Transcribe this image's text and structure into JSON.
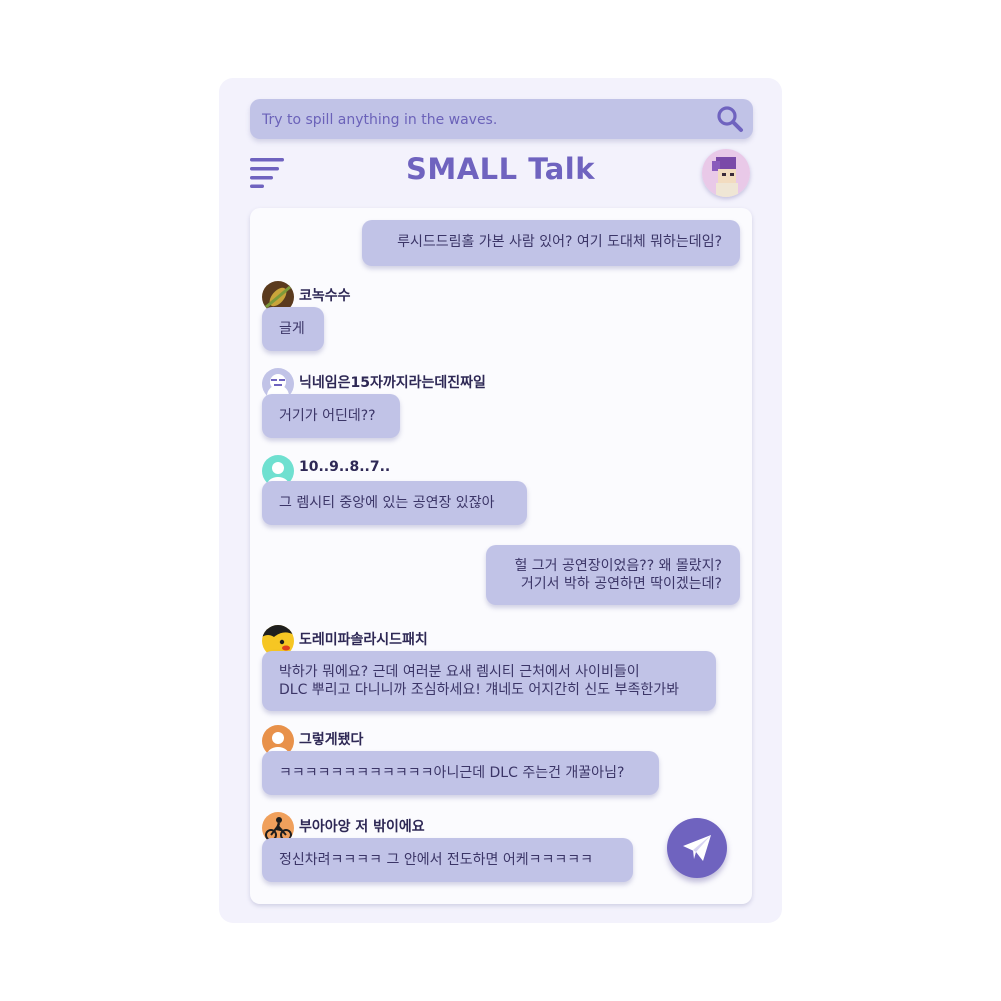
{
  "search": {
    "placeholder": "Try to spill anything in the waves."
  },
  "header": {
    "title": "SMALL Talk"
  },
  "colors": {
    "accent": "#6f63bf",
    "bubble": "#c1c3e7",
    "panel": "#f3f2fc",
    "text": "#3b3567"
  },
  "icons": {
    "search": "search-icon",
    "menu": "menu-icon",
    "send": "paper-plane-icon"
  },
  "messages": [
    {
      "type": "outgoing",
      "lines": [
        "루시드드림홀 가본 사람 있어? 여기 도대체 뭐하는데임?"
      ]
    },
    {
      "type": "incoming",
      "user": "코녹수수",
      "avatar": "corn-avatar",
      "lines": [
        "글게"
      ]
    },
    {
      "type": "incoming",
      "user": "닉네임은15자까지라는데진짜일",
      "avatar": "snowman-avatar",
      "lines": [
        "거기가 어딘데??"
      ]
    },
    {
      "type": "incoming",
      "user": "10..9..8..7..",
      "avatar": "default-teal-avatar",
      "lines": [
        "그 렘시티 중앙에 있는 공연장 있잖아"
      ]
    },
    {
      "type": "outgoing",
      "lines": [
        "헐 그거 공연장이었음?? 왜 몰랐지?",
        "거기서 박하 공연하면 딱이겠는데?"
      ]
    },
    {
      "type": "incoming",
      "user": "도레미파솔라시드패치",
      "avatar": "yellow-bird-avatar",
      "lines": [
        "박하가 뭐에요? 근데 여러분 요새 렘시티 근처에서 사이비들이",
        "DLC 뿌리고 다니니까 조심하세요! 걔네도 어지간히 신도 부족한가봐"
      ]
    },
    {
      "type": "incoming",
      "user": "그렇게됐다",
      "avatar": "default-orange-avatar",
      "lines": [
        "ㅋㅋㅋㅋㅋㅋㅋㅋㅋㅋㅋㅋ아니근데 DLC 주는건 개꿀아님?"
      ]
    },
    {
      "type": "incoming",
      "user": "부아아앙 저 밖이에요",
      "avatar": "bike-rider-avatar",
      "lines": [
        "정신차려ㅋㅋㅋㅋ 그 안에서 전도하면 어케ㅋㅋㅋㅋㅋ"
      ]
    }
  ]
}
